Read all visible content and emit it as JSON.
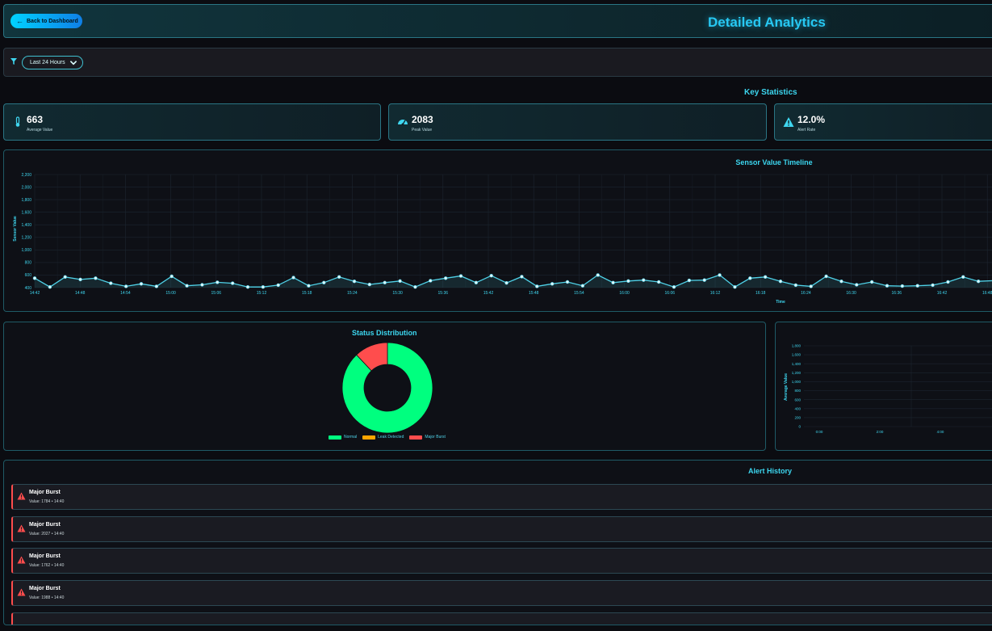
{
  "header": {
    "back_label": "Back to Dashboard",
    "title": "Detailed Analytics"
  },
  "filter": {
    "selected": "Last 24 Hours"
  },
  "stats": {
    "title": "Key Statistics",
    "cards": [
      {
        "value": "663",
        "label": "Average Value",
        "icon": "thermometer-icon"
      },
      {
        "value": "2083",
        "label": "Peak Value",
        "icon": "gauge-icon"
      },
      {
        "value": "12.0%",
        "label": "Alert Rate",
        "icon": "warning-icon"
      }
    ]
  },
  "colors": {
    "accent": "#27c8f3",
    "line": "#4fd2e8",
    "normal": "#00ff7f",
    "leak": "#ffa500",
    "burst": "#ff4d4d"
  },
  "chart_data": [
    {
      "type": "line",
      "title": "Sensor Value Timeline",
      "xlabel": "Time",
      "ylabel": "Sensor Value",
      "ylim": [
        400,
        2200
      ],
      "yticks": [
        400,
        600,
        800,
        1000,
        1200,
        1400,
        1600,
        1800,
        2000,
        2200
      ],
      "xtick_labels": [
        "14:42",
        "14:48",
        "14:54",
        "15:00",
        "15:06",
        "15:12",
        "15:18",
        "15:24",
        "15:30",
        "15:36",
        "15:42",
        "15:48",
        "15:54",
        "16:00",
        "16:06",
        "16:12",
        "16:18",
        "16:24",
        "16:30",
        "16:36",
        "16:42",
        "16:48"
      ],
      "values": [
        550,
        410,
        570,
        530,
        550,
        470,
        420,
        460,
        420,
        580,
        430,
        445,
        485,
        470,
        410,
        410,
        440,
        560,
        430,
        480,
        570,
        500,
        450,
        480,
        505,
        410,
        510,
        550,
        585,
        480,
        590,
        475,
        575,
        420,
        460,
        490,
        430,
        600,
        480,
        505,
        520,
        490,
        410,
        515,
        520,
        600,
        410,
        550,
        570,
        500,
        440,
        420,
        580,
        500,
        445,
        490,
        430,
        425,
        430,
        440,
        490,
        570,
        500,
        510
      ]
    },
    {
      "type": "pie",
      "title": "Status Distribution",
      "categories": [
        "Normal",
        "Leak Detected",
        "Major Burst"
      ],
      "values": [
        88,
        0,
        12
      ]
    },
    {
      "type": "bar",
      "title": "",
      "ylabel": "Average Value",
      "ylim": [
        0,
        1800
      ],
      "yticks": [
        0,
        200,
        400,
        600,
        800,
        1000,
        1200,
        1400,
        1600,
        1800
      ],
      "xtick_labels": [
        "0:00",
        "2:00",
        "4:00"
      ],
      "values": []
    }
  ],
  "alerts": {
    "title": "Alert History",
    "items": [
      {
        "name": "Major Burst",
        "meta": "Value: 1784 • 14:40"
      },
      {
        "name": "Major Burst",
        "meta": "Value: 2027 • 14:40"
      },
      {
        "name": "Major Burst",
        "meta": "Value: 1762 • 14:40"
      },
      {
        "name": "Major Burst",
        "meta": "Value: 1988 • 14:40"
      }
    ]
  }
}
